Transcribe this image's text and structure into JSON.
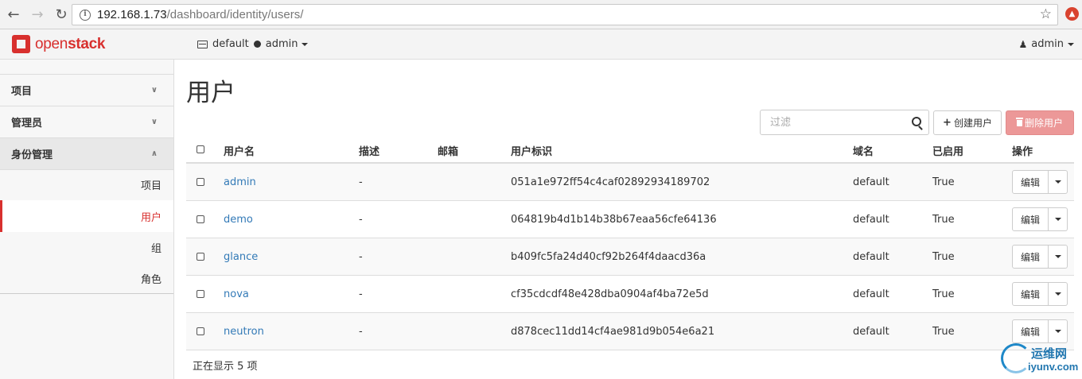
{
  "browser": {
    "url_host": "192.168.1.73",
    "url_path": "/dashboard/identity/users/"
  },
  "topnav": {
    "logo_light": "open",
    "logo_bold": "stack",
    "domain": "default",
    "project": "admin",
    "user": "admin"
  },
  "sidebar": {
    "groups": [
      {
        "label": "项目"
      },
      {
        "label": "管理员"
      },
      {
        "label": "身份管理"
      }
    ],
    "items": [
      {
        "label": "项目"
      },
      {
        "label": "用户"
      },
      {
        "label": "组"
      },
      {
        "label": "角色"
      }
    ]
  },
  "main": {
    "title": "用户",
    "filter_placeholder": "过滤",
    "create_label": "创建用户",
    "delete_label": "删除用户",
    "columns": {
      "name": "用户名",
      "description": "描述",
      "email": "邮箱",
      "id": "用户标识",
      "domain": "域名",
      "enabled": "已启用",
      "actions": "操作"
    },
    "rows": [
      {
        "name": "admin",
        "description": "-",
        "email": "",
        "id": "051a1e972ff54c4caf02892934189702",
        "domain": "default",
        "enabled": "True",
        "action": "编辑"
      },
      {
        "name": "demo",
        "description": "-",
        "email": "",
        "id": "064819b4d1b14b38b67eaa56cfe64136",
        "domain": "default",
        "enabled": "True",
        "action": "编辑"
      },
      {
        "name": "glance",
        "description": "-",
        "email": "",
        "id": "b409fc5fa24d40cf92b264f4daacd36a",
        "domain": "default",
        "enabled": "True",
        "action": "编辑"
      },
      {
        "name": "nova",
        "description": "-",
        "email": "",
        "id": "cf35cdcdf48e428dba0904af4ba72e5d",
        "domain": "default",
        "enabled": "True",
        "action": "编辑"
      },
      {
        "name": "neutron",
        "description": "-",
        "email": "",
        "id": "d878cec11dd14cf4ae981d9b054e6a21",
        "domain": "default",
        "enabled": "True",
        "action": "编辑"
      }
    ],
    "footer": "正在显示 5 项"
  },
  "watermark": {
    "cn": "运维网",
    "en": "iyunv.com"
  },
  "colors": {
    "brand": "#d8302e",
    "link": "#337ab7",
    "danger_disabled": "#ec9898"
  }
}
